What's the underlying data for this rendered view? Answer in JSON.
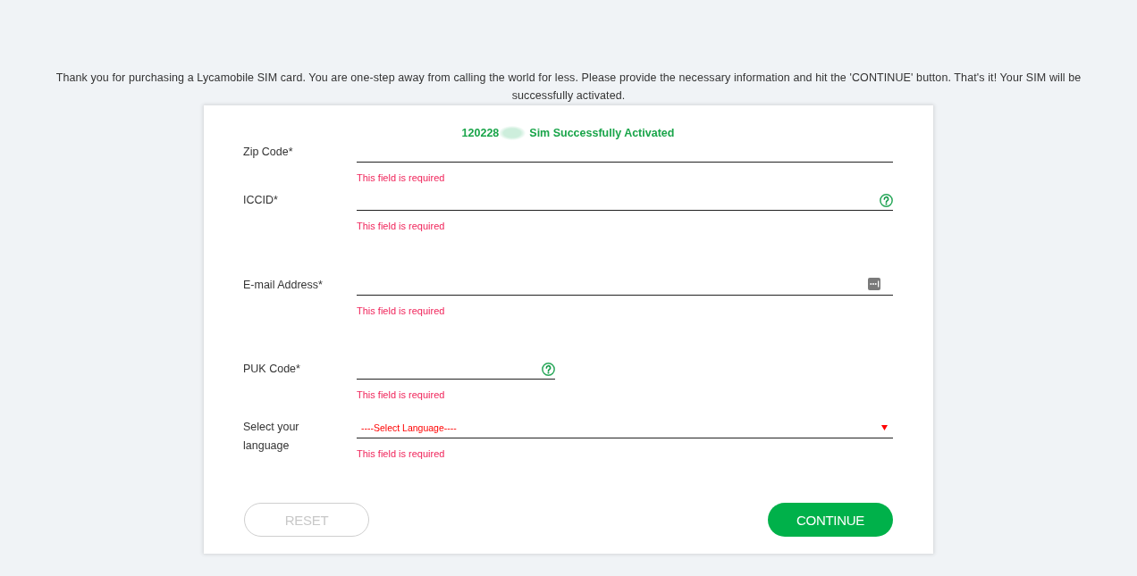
{
  "intro": "Thank you for purchasing a Lycamobile SIM card. You are one-step away from calling the world for less. Please provide the necessary information and hit the 'CONTINUE' button. That's it! Your SIM will be successfully activated.",
  "status": {
    "number": "120228",
    "redacted": true,
    "message": "Sim Successfully Activated"
  },
  "fields": [
    {
      "kind": "plain",
      "label": "Zip Code*",
      "error": "This field is required"
    },
    {
      "kind": "help",
      "label": "ICCID*",
      "error": "This field is required"
    },
    {
      "kind": "email",
      "label": "E-mail Address*",
      "error": "This field is required"
    },
    {
      "kind": "short",
      "label": "PUK Code*",
      "error": "This field is required"
    },
    {
      "kind": "select",
      "label": "Select your language",
      "value": "----Select Language----",
      "error": "This field is required"
    }
  ],
  "buttons": [
    {
      "kind": "secondary",
      "label": "RESET"
    },
    {
      "kind": "primary",
      "label": "CONTINUE"
    }
  ]
}
